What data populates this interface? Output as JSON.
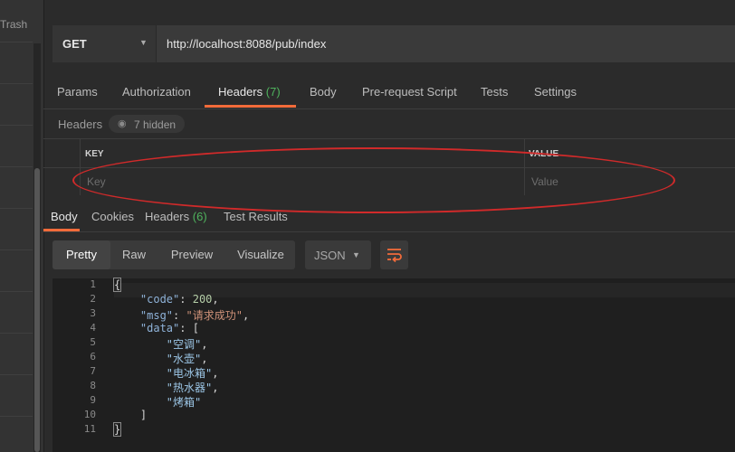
{
  "sidebar": {
    "trash_label": "Trash"
  },
  "request": {
    "method": "GET",
    "url": "http://localhost:8088/pub/index"
  },
  "request_tabs": {
    "params": "Params",
    "authorization": "Authorization",
    "headers": "Headers",
    "headers_count": "(7)",
    "body": "Body",
    "prerequest": "Pre-request Script",
    "tests": "Tests",
    "settings": "Settings"
  },
  "headers_panel": {
    "label": "Headers",
    "hidden": "7 hidden",
    "col_key": "KEY",
    "col_value": "VALUE",
    "key_placeholder": "Key",
    "value_placeholder": "Value"
  },
  "response_tabs": {
    "body": "Body",
    "cookies": "Cookies",
    "headers": "Headers",
    "headers_count": "(6)",
    "test_results": "Test Results"
  },
  "view": {
    "pretty": "Pretty",
    "raw": "Raw",
    "preview": "Preview",
    "visualize": "Visualize",
    "format": "JSON"
  },
  "code": {
    "line_numbers": [
      "1",
      "2",
      "3",
      "4",
      "5",
      "6",
      "7",
      "8",
      "9",
      "10",
      "11"
    ],
    "open_brace": "{",
    "code_key": "\"code\"",
    "code_value": "200",
    "msg_key": "\"msg\"",
    "msg_value": "\"请求成功\"",
    "data_key": "\"data\"",
    "data_open": "[",
    "items": [
      "\"空调\"",
      "\"水壶\"",
      "\"电冰箱\"",
      "\"热水器\"",
      "\"烤箱\""
    ],
    "data_close": "]",
    "close_brace": "}"
  },
  "colors": {
    "accent": "#f26b3a",
    "count_green": "#4fb35d",
    "annotation_red": "#d12a2a"
  },
  "icons": [
    "eye-icon",
    "caret-down-icon",
    "wrap-lines-icon"
  ]
}
